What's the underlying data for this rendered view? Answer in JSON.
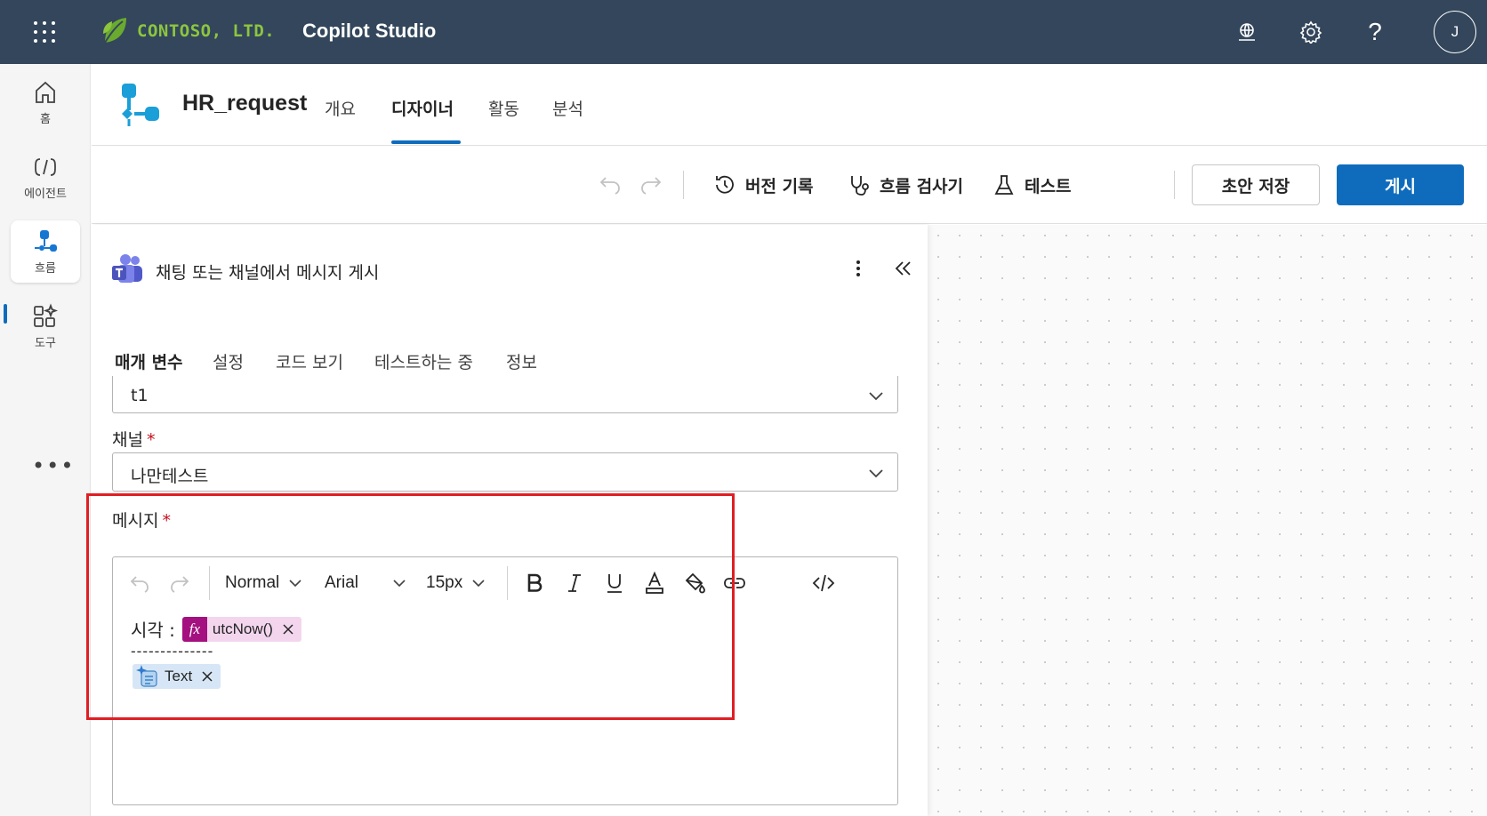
{
  "app": {
    "company": "CONTOSO, LTD.",
    "product": "Copilot Studio",
    "user_initial": "J"
  },
  "rail": {
    "items": [
      {
        "label": "홈",
        "icon": "home-icon"
      },
      {
        "label": "에이전트",
        "icon": "agent-icon"
      },
      {
        "label": "흐름",
        "icon": "flow-icon",
        "active": true
      },
      {
        "label": "도구",
        "icon": "tools-icon"
      }
    ],
    "more": "•••"
  },
  "header": {
    "flow_name": "HR_request",
    "tabs": [
      {
        "label": "개요"
      },
      {
        "label": "디자이너",
        "active": true
      },
      {
        "label": "활동"
      },
      {
        "label": "분석"
      }
    ]
  },
  "toolbar": {
    "version_history": "버전 기록",
    "flow_checker": "흐름 검사기",
    "test": "테스트",
    "save_draft": "초안 저장",
    "publish": "게시"
  },
  "panel": {
    "action_title": "채팅 또는 채널에서 메시지 게시",
    "tabs": [
      {
        "label": "매개 변수",
        "active": true
      },
      {
        "label": "설정"
      },
      {
        "label": "코드 보기"
      },
      {
        "label": "테스트하는 중"
      },
      {
        "label": "정보"
      }
    ],
    "team_value": "t1",
    "channel_label": "채널",
    "channel_value": "나만테스트",
    "message_label": "메시지",
    "required_mark": "*",
    "editor": {
      "style": "Normal",
      "font": "Arial",
      "size": "15px",
      "line1_label": "시각 :",
      "fx_glyph": "fx",
      "fx_token": "utcNow()",
      "dashes": "--------------",
      "text_token": "Text"
    }
  },
  "colors": {
    "topbar": "#33465b",
    "accent": "#0f6cbd",
    "highlight": "#e01e24",
    "fx_token": "#a4107f",
    "logo": "#8cc63f"
  }
}
